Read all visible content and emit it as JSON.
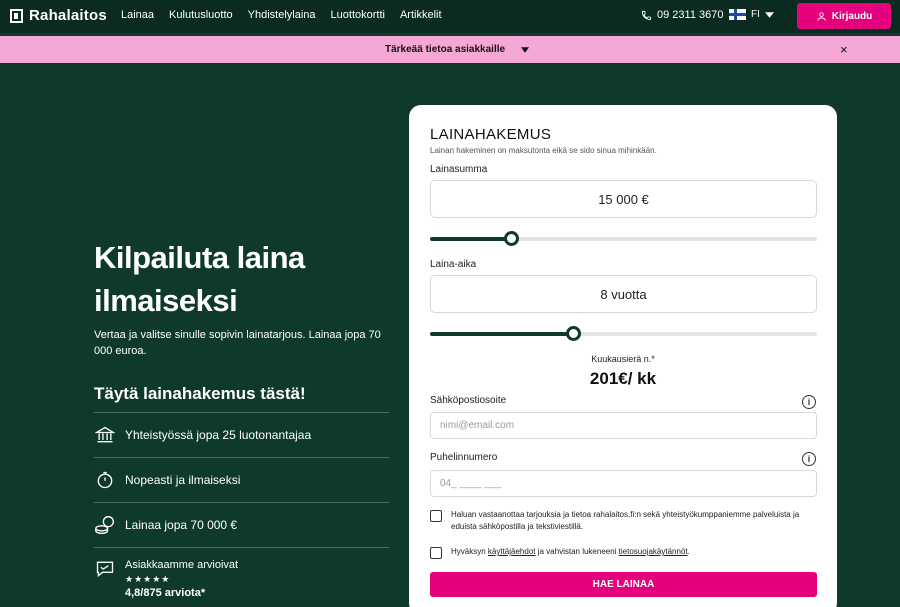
{
  "brand": {
    "name": "Rahalaitos"
  },
  "nav": {
    "links": [
      "Lainaa",
      "Kulutusluotto",
      "Yhdistelylaina",
      "Luottokortti",
      "Artikkelit"
    ],
    "phone": "09 2311 3670",
    "language": "FI",
    "login_label": "Kirjaudu"
  },
  "notice": {
    "text": "Tärkeää tietoa asiakkaille",
    "close": "×"
  },
  "hero": {
    "title": "Kilpailuta laina ilmaiseksi",
    "description": "Vertaa ja valitse sinulle sopivin lainatarjous. Lainaa jopa 70 000 euroa.",
    "subtitle": "Täytä lainahakemus tästä!",
    "features": [
      {
        "icon": "bank-icon",
        "text": "Yhteistyössä jopa 25 luotonantajaa"
      },
      {
        "icon": "stopwatch-icon",
        "text": "Nopeasti ja ilmaiseksi"
      },
      {
        "icon": "coins-icon",
        "text": "Lainaa jopa 70 000 €"
      }
    ],
    "rating": {
      "label": "Asiakkaamme arvioivat",
      "stars": "★★★★★",
      "score": "4,8/875 arviota*",
      "stars_value": 5
    }
  },
  "form": {
    "title": "LAINAHAKEMUS",
    "subtitle": "Lainan hakeminen on maksutonta eikä se sido sinua mihinkään.",
    "amount": {
      "label": "Lainasumma",
      "value": "15 000 €",
      "slider_fraction": 0.21
    },
    "term": {
      "label": "Laina-aika",
      "value": "8 vuotta",
      "slider_fraction": 0.37
    },
    "monthly": {
      "label": "Kuukausierä n.*",
      "value": "201€/ kk"
    },
    "email": {
      "label": "Sähköpostiosoite",
      "placeholder": "nimi@email.com"
    },
    "phone": {
      "label": "Puhelinnumero",
      "placeholder": "04_ ____ ___"
    },
    "consent_marketing": "Haluan vastaanottaa tarjouksia ja tietoa rahalaitos.fi:n sekä yhteistyökumppaniemme palveluista ja eduista sähköpostilla ja tekstiviestillä.",
    "consent_terms": {
      "before": "Hyväksyn ",
      "terms_link": "käyttäjäehdot",
      "middle": " ja vahvistan lukeneeni ",
      "privacy_link": "tietosuojakäytännöt",
      "after": "."
    },
    "submit_label": "HAE LAINAA"
  },
  "colors": {
    "brand_green": "#0f3a2b",
    "nav_dark": "#0b2b20",
    "accent_pink": "#e5007e",
    "notice_pink": "#f5a7d6"
  }
}
